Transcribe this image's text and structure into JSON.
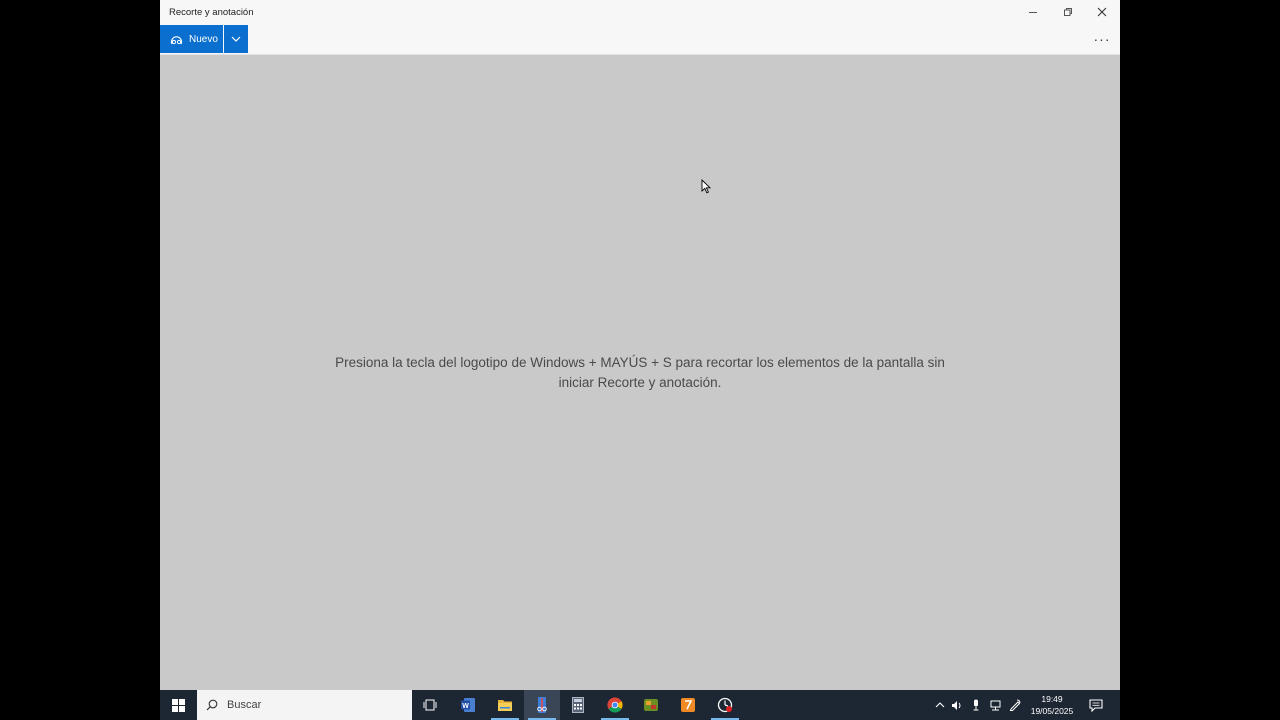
{
  "window": {
    "title": "Recorte y anotación"
  },
  "toolbar": {
    "new_label": "Nuevo",
    "more_label": "···"
  },
  "content": {
    "hint": "Presiona la tecla del logotipo de Windows + MAYÚS + S para recortar los elementos de la pantalla sin iniciar Recorte y anotación."
  },
  "taskbar": {
    "search_placeholder": "Buscar",
    "apps": [
      "task-view-icon",
      "word-icon",
      "file-explorer-icon",
      "snipping-tool-icon",
      "calculator-icon",
      "chrome-icon",
      "app-icon",
      "office-icon",
      "screen-recorder-icon"
    ],
    "clock": {
      "time": "19:49",
      "date": "19/05/2025"
    }
  },
  "colors": {
    "accent": "#0a6fce",
    "taskbar": "#1d2633",
    "content_bg": "#c9c9c9"
  }
}
